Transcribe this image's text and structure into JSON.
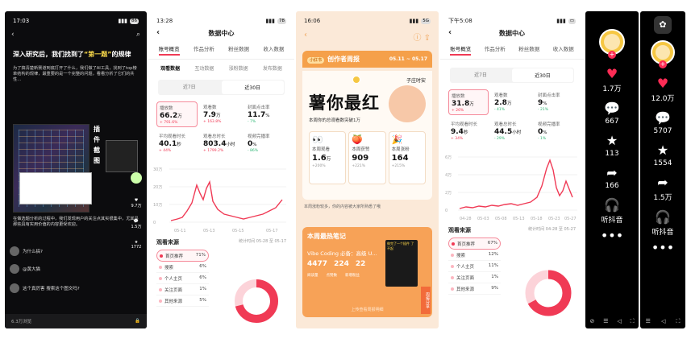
{
  "colors": {
    "accent": "#fe2c55",
    "orange": "#f5a04a",
    "green": "#2bb673"
  },
  "p1": {
    "time": "17:03",
    "battery": "86",
    "title_pre": "深入研究后，我们找到了",
    "title_hl": "“第一题”",
    "title_post": "的规律",
    "body": "为了搞清楚新赛道到底打开了什么，我们做了AI工具，找到了top榜单结构的规律，最重要的是一个完整的问题，看看分析了它们的共性…",
    "plug_label": "插件截图",
    "thumbs_text": "在做选题分析的过程中，我们发现用户的关注点其实很集中，尤其是那些具有实用价值的内容更受欢迎。",
    "side_count1": "9.7万",
    "side_count2": "1.5万",
    "side_count3": "1772",
    "comment1": "为什么搞?",
    "comment2": "@黄大猫",
    "comment3": "这个真厉害 搜索这个图文吗?",
    "bottom_left": "6.3万浏览",
    "bottom_right": "🔒"
  },
  "p2": {
    "time": "13:28",
    "battery": "78",
    "title": "数据中心",
    "tabs": [
      "账号概览",
      "作品分析",
      "粉丝数据",
      "收入数据"
    ],
    "subtabs": [
      "观看数据",
      "互动数据",
      "涨粉数据",
      "发布数据"
    ],
    "seg": [
      "近7日",
      "近30日"
    ],
    "metrics": [
      {
        "label": "播放数",
        "value": "66.2",
        "unit": "万",
        "delta": "+ 791.6%"
      },
      {
        "label": "观看数",
        "value": "7.9",
        "unit": "万",
        "delta": "+ 163.8%"
      },
      {
        "label": "封面点击率",
        "value": "11.7",
        "unit": "%",
        "delta": "- 7%"
      },
      {
        "label": "平均观看时长",
        "value": "40.1",
        "unit": "秒",
        "delta": "+ 44%"
      },
      {
        "label": "观看总时长",
        "value": "803.4",
        "unit": "小时",
        "delta": "+ 1799.2%"
      },
      {
        "label": "视频完播率",
        "value": "0",
        "unit": "%",
        "delta": "- 86%"
      }
    ],
    "chart_yticks": [
      "30万",
      "20万",
      "10万",
      "0"
    ],
    "chart_xticks": [
      "05-11",
      "05-13",
      "05-15",
      "05-17"
    ],
    "src_title": "观看来源",
    "src_note": "统计时间 05-28 至 05-17",
    "sources": [
      {
        "name": "首页推荐",
        "pct": "71%"
      },
      {
        "name": "搜索",
        "pct": "6%"
      },
      {
        "name": "个人主页",
        "pct": "6%"
      },
      {
        "name": "关注页面",
        "pct": "1%"
      },
      {
        "name": "其他来源",
        "pct": "5%"
      }
    ]
  },
  "p3": {
    "time": "16:06",
    "battery": "5G",
    "pill": "小红书",
    "banner": "创作者周报",
    "date": "05.11 ~ 05.17",
    "author": "子庄时安",
    "big": "薯你最红",
    "sub": "本周你的总观看数突破1万",
    "stats": [
      {
        "label": "本周观看",
        "value": "1.6",
        "unit": "万",
        "delta": "+200%"
      },
      {
        "label": "本周获赞",
        "value": "909",
        "unit": "",
        "delta": "+221%"
      },
      {
        "label": "本周涨粉",
        "value": "164",
        "unit": "",
        "delta": "+215%"
      }
    ],
    "note": "本周涨粉较多，你的内容被大家所熟悉了哦",
    "hot_title": "本周最热笔记",
    "hot_note": "Vibe Coding 必备：高级 U...",
    "hot_nums": [
      "4477",
      "224",
      "22"
    ],
    "hot_lbls": [
      "阅读量",
      "点赞数",
      "新增粉丝"
    ],
    "hot_thumb": "做完了一个插件 了不起",
    "hot_link": "上传查看周报明细",
    "ribbon": "周报分享"
  },
  "p4": {
    "time": "下午5:08",
    "title": "数据中心",
    "tabs": [
      "账号概览",
      "作品分析",
      "粉丝数据",
      "收入数据"
    ],
    "seg": [
      "近7日",
      "近30日"
    ],
    "metrics": [
      {
        "label": "播放数",
        "value": "31.8",
        "unit": "万",
        "delta": "+ 26%"
      },
      {
        "label": "观看数",
        "value": "2.8",
        "unit": "万",
        "delta": "- 41%"
      },
      {
        "label": "封面点击率",
        "value": "9",
        "unit": "%",
        "delta": "- 21%"
      },
      {
        "label": "平均观看时长",
        "value": "9.4",
        "unit": "秒",
        "delta": "+ 34%"
      },
      {
        "label": "观看总时长",
        "value": "44.5",
        "unit": "小时",
        "delta": "- 29%"
      },
      {
        "label": "视频完播率",
        "value": "0",
        "unit": "%",
        "delta": "- 1%"
      }
    ],
    "chart_yticks": [
      "6万",
      "4万",
      "2万",
      "0"
    ],
    "chart_xticks": [
      "04-28",
      "05-03",
      "05-08",
      "05-13",
      "05-18",
      "05-23",
      "05-27"
    ],
    "src_title": "观看来源",
    "src_note": "统计时间 04-28 至 05-27",
    "sources": [
      {
        "name": "首页推荐",
        "pct": "67%"
      },
      {
        "name": "搜索",
        "pct": "12%"
      },
      {
        "name": "个人主页",
        "pct": "11%"
      },
      {
        "name": "关注页面",
        "pct": "1%"
      },
      {
        "name": "其他来源",
        "pct": "9%"
      }
    ]
  },
  "p5": {
    "likes": "1.7万",
    "comments": "667",
    "favs": "113",
    "shares": "166",
    "music": "听抖音"
  },
  "p6": {
    "likes": "12.0万",
    "comments": "5707",
    "favs": "1554",
    "shares": "1.5万",
    "music": "听抖音"
  }
}
